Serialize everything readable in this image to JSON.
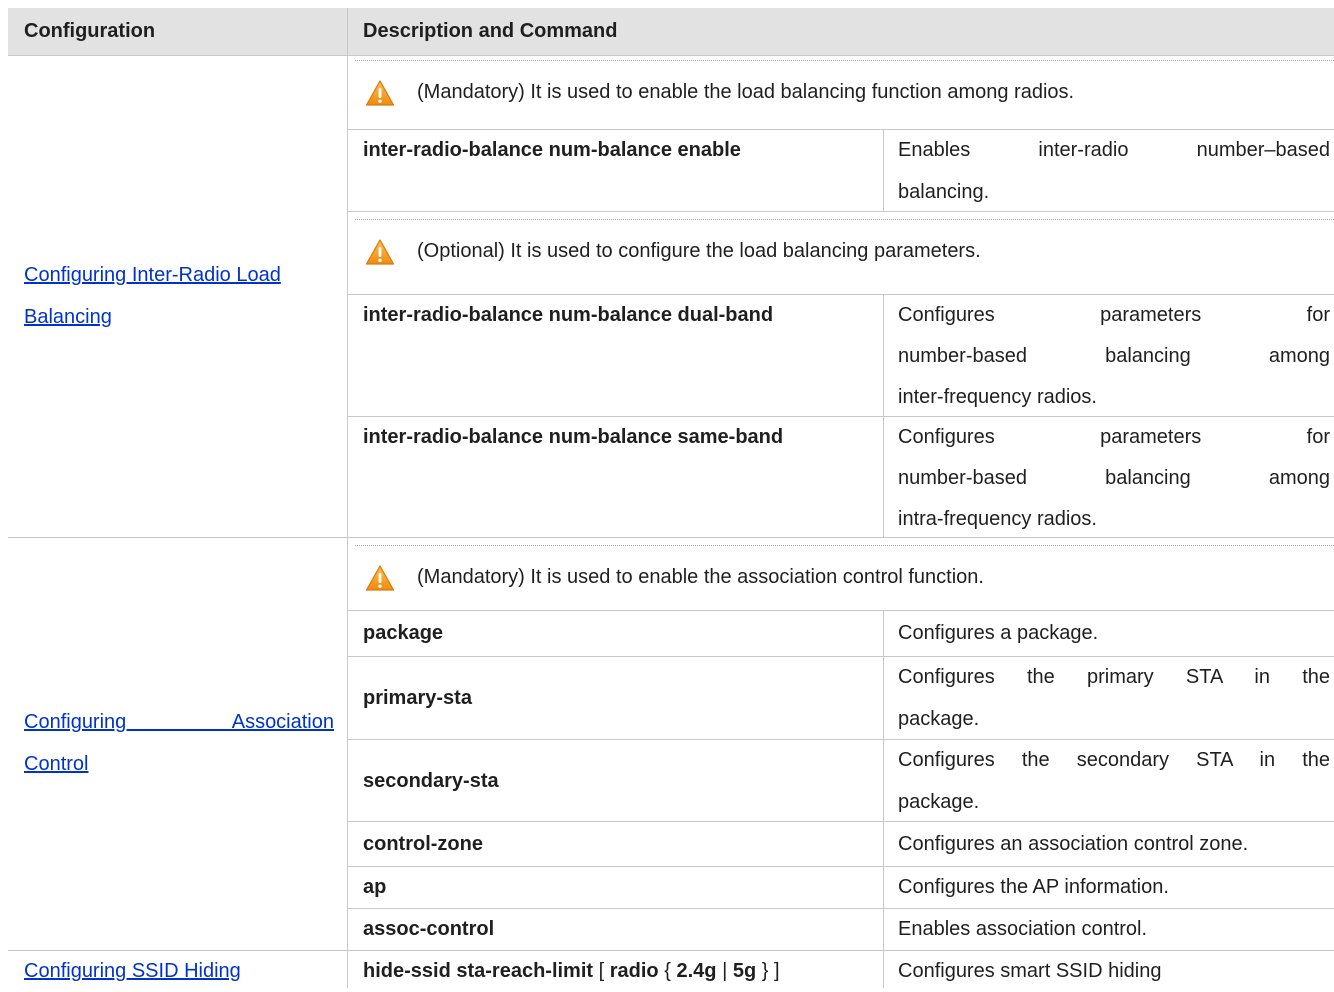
{
  "header": {
    "col_configuration": "Configuration",
    "col_description": "Description and Command"
  },
  "icons": {
    "warning": "warning-triangle-icon",
    "warning_fill": "#f5a623"
  },
  "colors": {
    "link": "#0033cc",
    "header_bg": "#e2e2e2"
  },
  "sections": [
    {
      "link_line1": "Configuring Inter-Radio Load",
      "link_line2": "Balancing",
      "notes": [
        "(Mandatory) It is used to enable the load balancing function among radios.",
        "(Optional) It is used to configure the load balancing parameters."
      ],
      "rows": [
        {
          "command": "inter-radio-balance num-balance enable",
          "desc": [
            "Enables inter-radio number–based",
            "balancing."
          ]
        },
        {
          "command": "inter-radio-balance num-balance dual-band",
          "desc": [
            "Configures parameters for",
            "number-based balancing among",
            "inter-frequency radios."
          ]
        },
        {
          "command": "inter-radio-balance num-balance same-band",
          "desc": [
            "Configures parameters for",
            "number-based balancing among",
            "intra-frequency radios."
          ]
        }
      ]
    },
    {
      "link_line1": "Configuring Association",
      "link_line2": "Control",
      "notes": [
        "(Mandatory) It is used to enable the association control function."
      ],
      "rows": [
        {
          "command": "package",
          "desc": [
            "Configures a package."
          ]
        },
        {
          "command": "primary-sta",
          "desc": [
            "Configures the primary STA in the",
            "package."
          ]
        },
        {
          "command": "secondary-sta",
          "desc": [
            "Configures the secondary STA in the",
            "package."
          ]
        },
        {
          "command": "control-zone",
          "desc": [
            "Configures an association control zone."
          ]
        },
        {
          "command": "ap",
          "desc": [
            "Configures the AP information."
          ]
        },
        {
          "command": "assoc-control",
          "desc": [
            "Enables association control."
          ]
        }
      ]
    },
    {
      "link_line1": "Configuring SSID Hiding",
      "rows": [
        {
          "cmd_parts": [
            "hide-ssid sta-reach-limit",
            "[",
            "radio",
            "{",
            "2.4g",
            "|",
            "5g",
            "}",
            "]"
          ],
          "desc": [
            "Configures smart SSID hiding"
          ]
        }
      ]
    }
  ]
}
